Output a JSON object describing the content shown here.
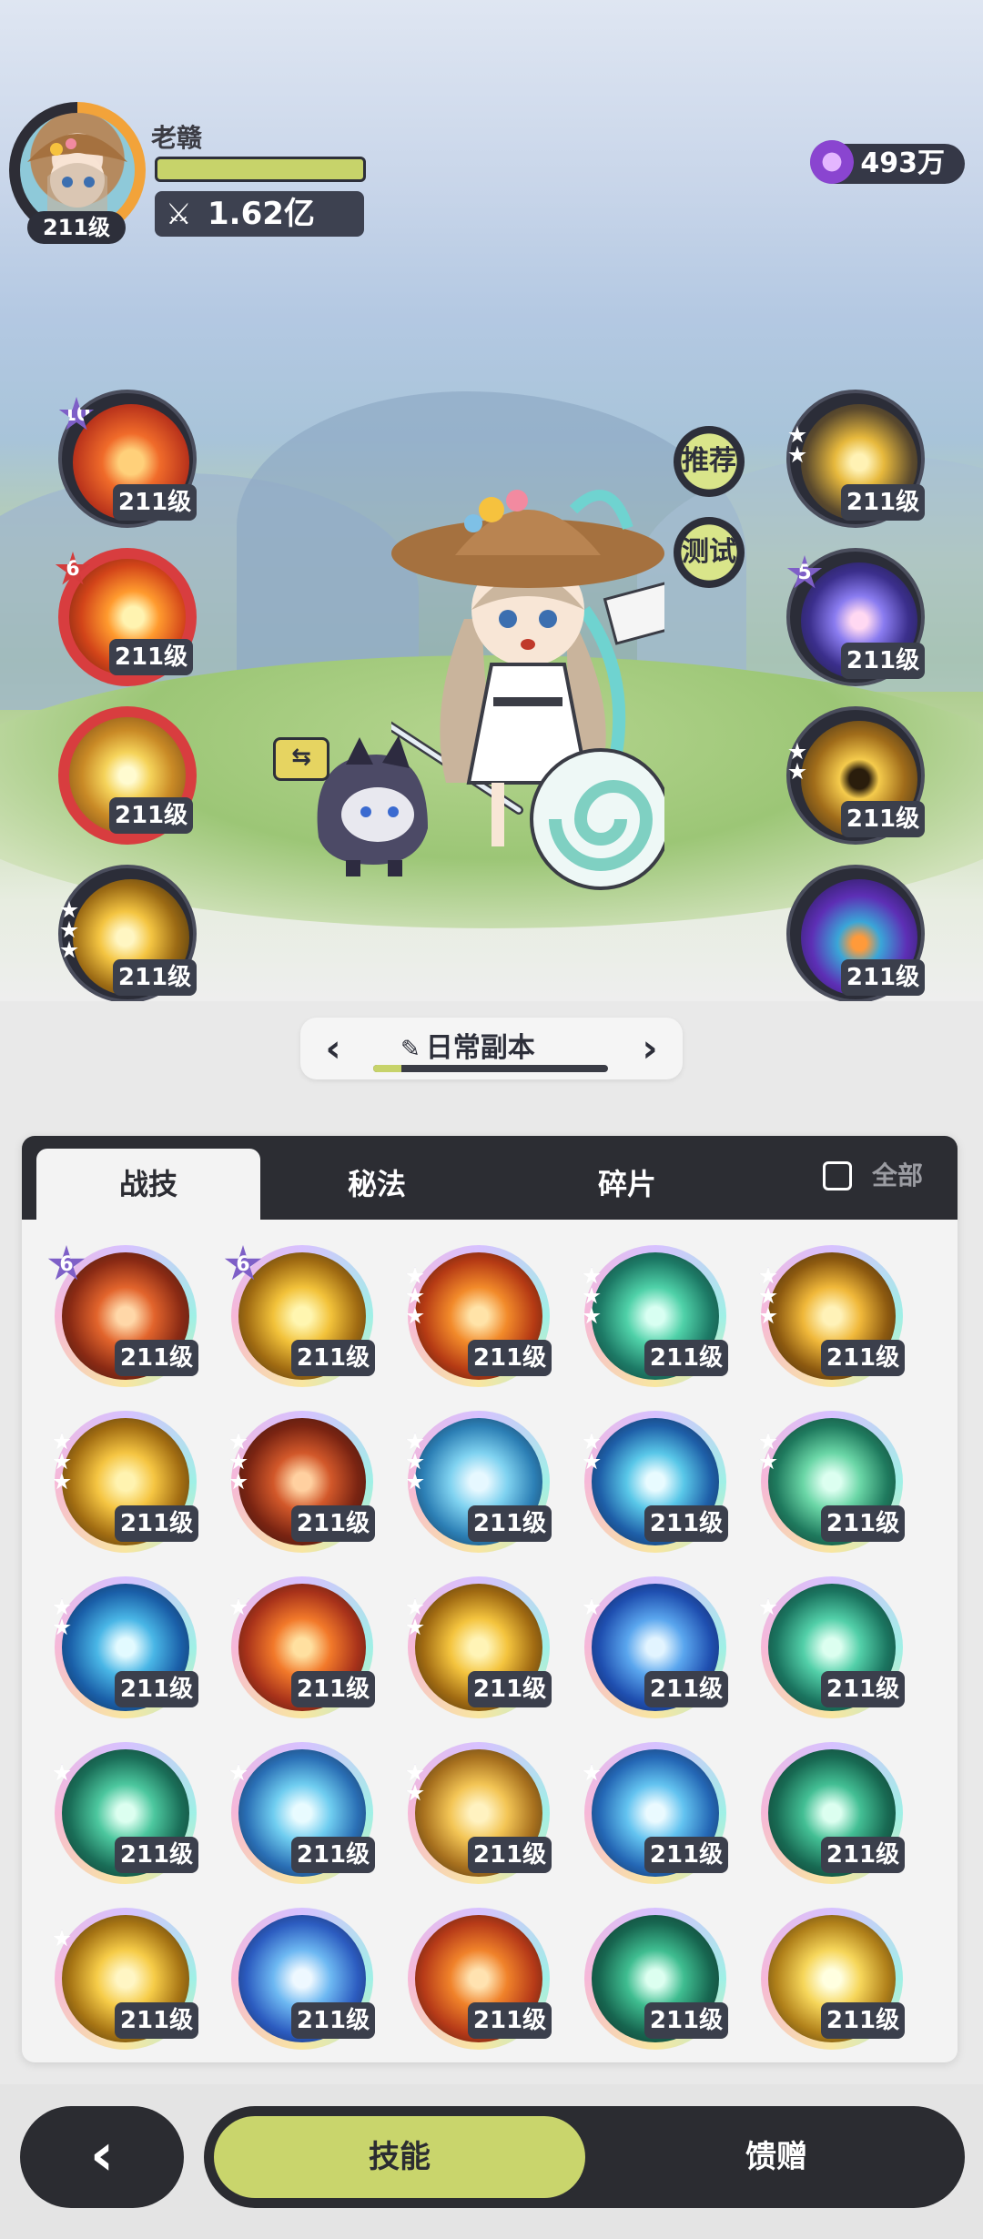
{
  "player": {
    "name": "老赣",
    "level": "211级",
    "power": "1.62亿",
    "currency": "493万"
  },
  "scene_buttons": {
    "recommend": "推荐",
    "test": "测试"
  },
  "left_skills": [
    {
      "level": "211级",
      "badge": "10"
    },
    {
      "level": "211级",
      "badge": "6"
    },
    {
      "level": "211级",
      "badge": ""
    },
    {
      "level": "211级",
      "badge": ""
    }
  ],
  "right_skills": [
    {
      "level": "211级",
      "badge": ""
    },
    {
      "level": "211级",
      "badge": "5"
    },
    {
      "level": "211级",
      "badge": ""
    },
    {
      "level": "211级",
      "badge": ""
    }
  ],
  "stage": {
    "label": "日常副本",
    "progress": 0.12
  },
  "tabs": {
    "skills": "战技",
    "arcane": "秘法",
    "shards": "碎片",
    "all": "全部"
  },
  "grid": [
    {
      "level": "211级",
      "badge": "6"
    },
    {
      "level": "211级",
      "badge": "6"
    },
    {
      "level": "211级",
      "badge": ""
    },
    {
      "level": "211级",
      "badge": ""
    },
    {
      "level": "211级",
      "badge": ""
    },
    {
      "level": "211级",
      "badge": ""
    },
    {
      "level": "211级",
      "badge": ""
    },
    {
      "level": "211级",
      "badge": ""
    },
    {
      "level": "211级",
      "badge": ""
    },
    {
      "level": "211级",
      "badge": ""
    },
    {
      "level": "211级",
      "badge": ""
    },
    {
      "level": "211级",
      "badge": ""
    },
    {
      "level": "211级",
      "badge": ""
    },
    {
      "level": "211级",
      "badge": ""
    },
    {
      "level": "211级",
      "badge": ""
    },
    {
      "level": "211级",
      "badge": ""
    },
    {
      "level": "211级",
      "badge": ""
    },
    {
      "level": "211级",
      "badge": ""
    },
    {
      "level": "211级",
      "badge": ""
    },
    {
      "level": "211级",
      "badge": ""
    },
    {
      "level": "211级",
      "badge": ""
    },
    {
      "level": "211级",
      "badge": ""
    },
    {
      "level": "211级",
      "badge": ""
    },
    {
      "level": "211级",
      "badge": ""
    },
    {
      "level": "211级",
      "badge": ""
    }
  ],
  "nav": {
    "skill": "技能",
    "gift": "馈赠"
  },
  "colors": {
    "accent": "#c9d56c",
    "dark": "#2b2c31"
  }
}
